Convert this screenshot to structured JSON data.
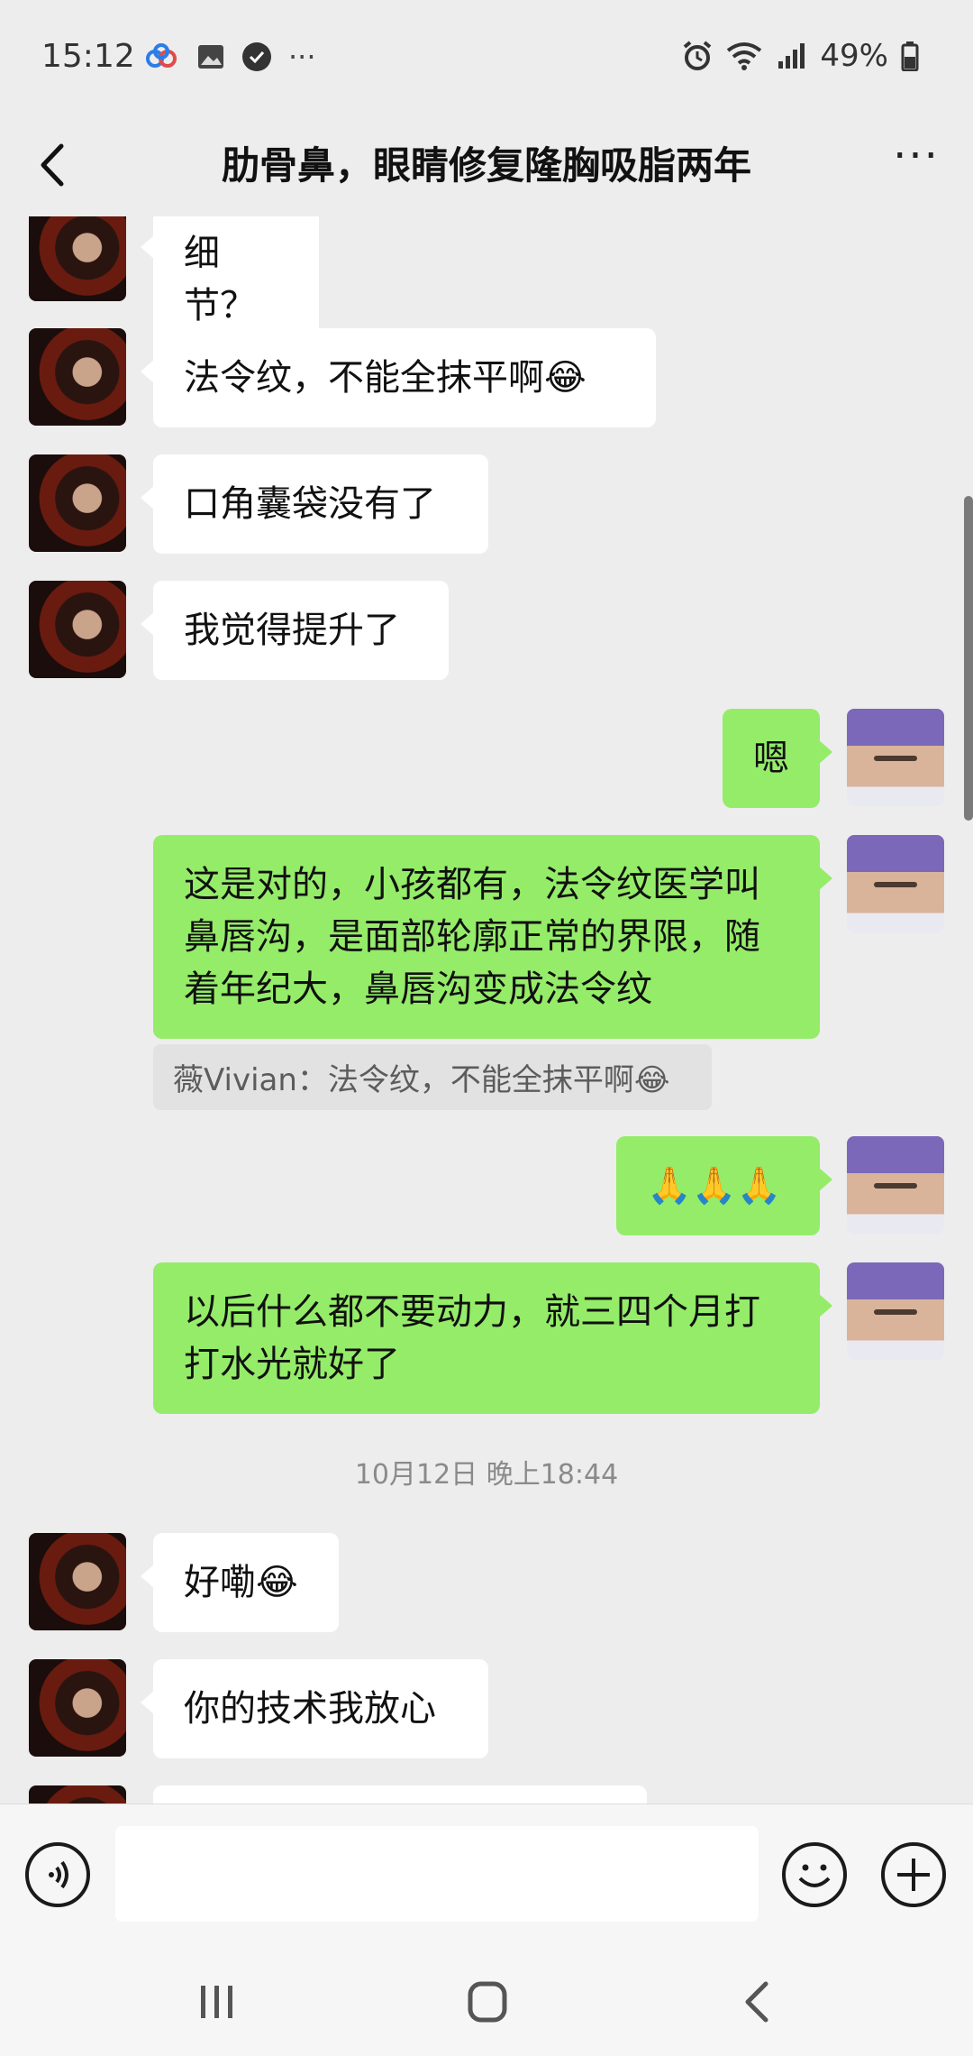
{
  "status_bar": {
    "time": "15:12",
    "icons_left": [
      "cloud-icon",
      "image-icon",
      "app-badge-icon",
      "more-dots-icon"
    ],
    "icons_right": [
      "alarm-icon",
      "wifi-icon",
      "signal-2g-icon"
    ],
    "battery": "49%"
  },
  "header": {
    "title": "肋骨鼻，眼睛修复隆胸吸脂两年",
    "more": "···"
  },
  "messages": [
    {
      "side": "left",
      "text": "细节？"
    },
    {
      "side": "left",
      "text": "法令纹，不能全抹平啊😂"
    },
    {
      "side": "left",
      "text": "口角囊袋没有了"
    },
    {
      "side": "left",
      "text": "我觉得提升了"
    },
    {
      "side": "right",
      "text": "嗯"
    },
    {
      "side": "right",
      "text": "这是对的，小孩都有，法令纹医学叫鼻唇沟，是面部轮廓正常的界限，随着年纪大，鼻唇沟变成法令纹"
    },
    {
      "side": "right",
      "text": "🙏🙏🙏"
    },
    {
      "side": "right",
      "text": "以后什么都不要动力，就三四个月打打水光就好了"
    },
    {
      "side": "left",
      "text": "好嘞😂"
    },
    {
      "side": "left",
      "text": "你的技术我放心"
    }
  ],
  "quote": "薇Vivian：法令纹，不能全抹平啊😂",
  "timestamp": "10月12日 晚上18:44",
  "input": {
    "value": "",
    "placeholder": ""
  },
  "nav": [
    "recent-apps-icon",
    "home-icon",
    "back-icon"
  ]
}
